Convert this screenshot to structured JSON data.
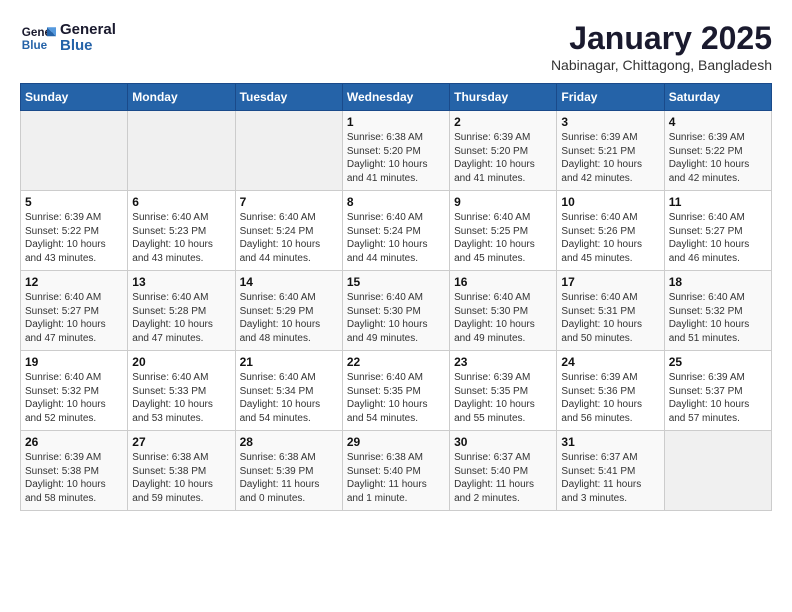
{
  "logo": {
    "line1": "General",
    "line2": "Blue"
  },
  "title": "January 2025",
  "subtitle": "Nabinagar, Chittagong, Bangladesh",
  "weekdays": [
    "Sunday",
    "Monday",
    "Tuesday",
    "Wednesday",
    "Thursday",
    "Friday",
    "Saturday"
  ],
  "weeks": [
    [
      {
        "num": "",
        "info": ""
      },
      {
        "num": "",
        "info": ""
      },
      {
        "num": "",
        "info": ""
      },
      {
        "num": "1",
        "info": "Sunrise: 6:38 AM\nSunset: 5:20 PM\nDaylight: 10 hours\nand 41 minutes."
      },
      {
        "num": "2",
        "info": "Sunrise: 6:39 AM\nSunset: 5:20 PM\nDaylight: 10 hours\nand 41 minutes."
      },
      {
        "num": "3",
        "info": "Sunrise: 6:39 AM\nSunset: 5:21 PM\nDaylight: 10 hours\nand 42 minutes."
      },
      {
        "num": "4",
        "info": "Sunrise: 6:39 AM\nSunset: 5:22 PM\nDaylight: 10 hours\nand 42 minutes."
      }
    ],
    [
      {
        "num": "5",
        "info": "Sunrise: 6:39 AM\nSunset: 5:22 PM\nDaylight: 10 hours\nand 43 minutes."
      },
      {
        "num": "6",
        "info": "Sunrise: 6:40 AM\nSunset: 5:23 PM\nDaylight: 10 hours\nand 43 minutes."
      },
      {
        "num": "7",
        "info": "Sunrise: 6:40 AM\nSunset: 5:24 PM\nDaylight: 10 hours\nand 44 minutes."
      },
      {
        "num": "8",
        "info": "Sunrise: 6:40 AM\nSunset: 5:24 PM\nDaylight: 10 hours\nand 44 minutes."
      },
      {
        "num": "9",
        "info": "Sunrise: 6:40 AM\nSunset: 5:25 PM\nDaylight: 10 hours\nand 45 minutes."
      },
      {
        "num": "10",
        "info": "Sunrise: 6:40 AM\nSunset: 5:26 PM\nDaylight: 10 hours\nand 45 minutes."
      },
      {
        "num": "11",
        "info": "Sunrise: 6:40 AM\nSunset: 5:27 PM\nDaylight: 10 hours\nand 46 minutes."
      }
    ],
    [
      {
        "num": "12",
        "info": "Sunrise: 6:40 AM\nSunset: 5:27 PM\nDaylight: 10 hours\nand 47 minutes."
      },
      {
        "num": "13",
        "info": "Sunrise: 6:40 AM\nSunset: 5:28 PM\nDaylight: 10 hours\nand 47 minutes."
      },
      {
        "num": "14",
        "info": "Sunrise: 6:40 AM\nSunset: 5:29 PM\nDaylight: 10 hours\nand 48 minutes."
      },
      {
        "num": "15",
        "info": "Sunrise: 6:40 AM\nSunset: 5:30 PM\nDaylight: 10 hours\nand 49 minutes."
      },
      {
        "num": "16",
        "info": "Sunrise: 6:40 AM\nSunset: 5:30 PM\nDaylight: 10 hours\nand 49 minutes."
      },
      {
        "num": "17",
        "info": "Sunrise: 6:40 AM\nSunset: 5:31 PM\nDaylight: 10 hours\nand 50 minutes."
      },
      {
        "num": "18",
        "info": "Sunrise: 6:40 AM\nSunset: 5:32 PM\nDaylight: 10 hours\nand 51 minutes."
      }
    ],
    [
      {
        "num": "19",
        "info": "Sunrise: 6:40 AM\nSunset: 5:32 PM\nDaylight: 10 hours\nand 52 minutes."
      },
      {
        "num": "20",
        "info": "Sunrise: 6:40 AM\nSunset: 5:33 PM\nDaylight: 10 hours\nand 53 minutes."
      },
      {
        "num": "21",
        "info": "Sunrise: 6:40 AM\nSunset: 5:34 PM\nDaylight: 10 hours\nand 54 minutes."
      },
      {
        "num": "22",
        "info": "Sunrise: 6:40 AM\nSunset: 5:35 PM\nDaylight: 10 hours\nand 54 minutes."
      },
      {
        "num": "23",
        "info": "Sunrise: 6:39 AM\nSunset: 5:35 PM\nDaylight: 10 hours\nand 55 minutes."
      },
      {
        "num": "24",
        "info": "Sunrise: 6:39 AM\nSunset: 5:36 PM\nDaylight: 10 hours\nand 56 minutes."
      },
      {
        "num": "25",
        "info": "Sunrise: 6:39 AM\nSunset: 5:37 PM\nDaylight: 10 hours\nand 57 minutes."
      }
    ],
    [
      {
        "num": "26",
        "info": "Sunrise: 6:39 AM\nSunset: 5:38 PM\nDaylight: 10 hours\nand 58 minutes."
      },
      {
        "num": "27",
        "info": "Sunrise: 6:38 AM\nSunset: 5:38 PM\nDaylight: 10 hours\nand 59 minutes."
      },
      {
        "num": "28",
        "info": "Sunrise: 6:38 AM\nSunset: 5:39 PM\nDaylight: 11 hours\nand 0 minutes."
      },
      {
        "num": "29",
        "info": "Sunrise: 6:38 AM\nSunset: 5:40 PM\nDaylight: 11 hours\nand 1 minute."
      },
      {
        "num": "30",
        "info": "Sunrise: 6:37 AM\nSunset: 5:40 PM\nDaylight: 11 hours\nand 2 minutes."
      },
      {
        "num": "31",
        "info": "Sunrise: 6:37 AM\nSunset: 5:41 PM\nDaylight: 11 hours\nand 3 minutes."
      },
      {
        "num": "",
        "info": ""
      }
    ]
  ]
}
